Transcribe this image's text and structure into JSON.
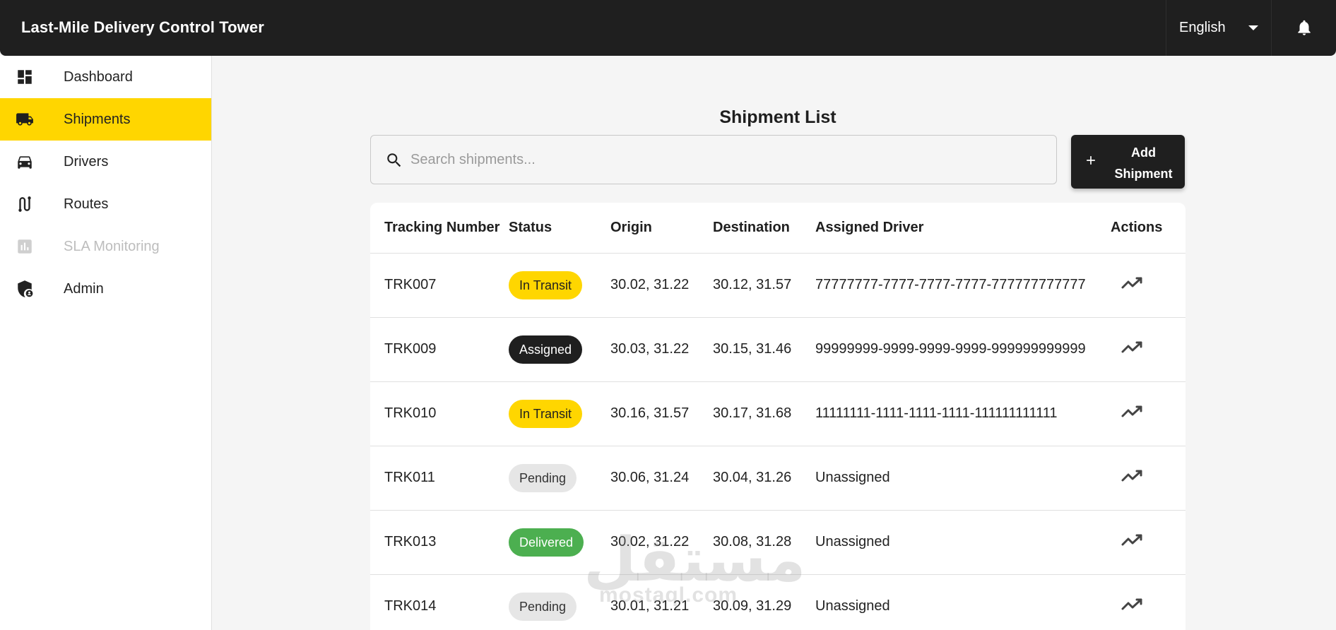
{
  "header": {
    "title": "Last-Mile Delivery Control Tower",
    "language": "English"
  },
  "sidebar": {
    "items": [
      {
        "label": "Dashboard",
        "icon": "dashboard-icon"
      },
      {
        "label": "Shipments",
        "icon": "truck-icon",
        "active": true
      },
      {
        "label": "Drivers",
        "icon": "car-icon"
      },
      {
        "label": "Routes",
        "icon": "route-icon"
      },
      {
        "label": "SLA Monitoring",
        "icon": "bar-chart-icon",
        "disabled": true
      },
      {
        "label": "Admin",
        "icon": "admin-shield-icon"
      }
    ]
  },
  "main": {
    "title": "Shipment List",
    "search_placeholder": "Search shipments...",
    "add_button": "Add Shipment"
  },
  "table": {
    "headers": [
      "Tracking Number",
      "Status",
      "Origin",
      "Destination",
      "Assigned Driver",
      "Actions"
    ],
    "rows": [
      {
        "tracking": "TRK007",
        "status": "In Transit",
        "origin": "30.02, 31.22",
        "destination": "30.12, 31.57",
        "driver": "77777777-7777-7777-7777-777777777777"
      },
      {
        "tracking": "TRK009",
        "status": "Assigned",
        "origin": "30.03, 31.22",
        "destination": "30.15, 31.46",
        "driver": "99999999-9999-9999-9999-999999999999"
      },
      {
        "tracking": "TRK010",
        "status": "In Transit",
        "origin": "30.16, 31.57",
        "destination": "30.17, 31.68",
        "driver": "11111111-1111-1111-1111-111111111111"
      },
      {
        "tracking": "TRK011",
        "status": "Pending",
        "origin": "30.06, 31.24",
        "destination": "30.04, 31.26",
        "driver": "Unassigned"
      },
      {
        "tracking": "TRK013",
        "status": "Delivered",
        "origin": "30.02, 31.22",
        "destination": "30.08, 31.28",
        "driver": "Unassigned"
      },
      {
        "tracking": "TRK014",
        "status": "Pending",
        "origin": "30.01, 31.21",
        "destination": "30.09, 31.29",
        "driver": "Unassigned"
      }
    ]
  },
  "watermark": {
    "text": "مستقل",
    "sub": "mostaql.com"
  },
  "colors": {
    "accent": "#ffd600",
    "topbar": "#1f1f1f",
    "delivered": "#4caf50",
    "pending": "#e6e6e6"
  }
}
